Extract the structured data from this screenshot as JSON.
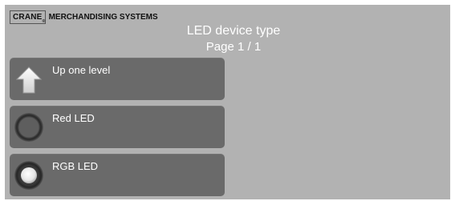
{
  "brand": {
    "logo": "CRANE",
    "logo_mark": "®",
    "name": "MERCHANDISING SYSTEMS"
  },
  "header": {
    "title": "LED device type",
    "page": "Page 1 / 1"
  },
  "items": [
    {
      "label": "Up one level",
      "icon": "up-arrow-icon"
    },
    {
      "label": "Red LED",
      "icon": "led-off-icon"
    },
    {
      "label": "RGB LED",
      "icon": "led-on-icon"
    }
  ],
  "colors": {
    "background": "#b2b2b2",
    "button": "#6a6a6a",
    "text": "#ffffff"
  }
}
